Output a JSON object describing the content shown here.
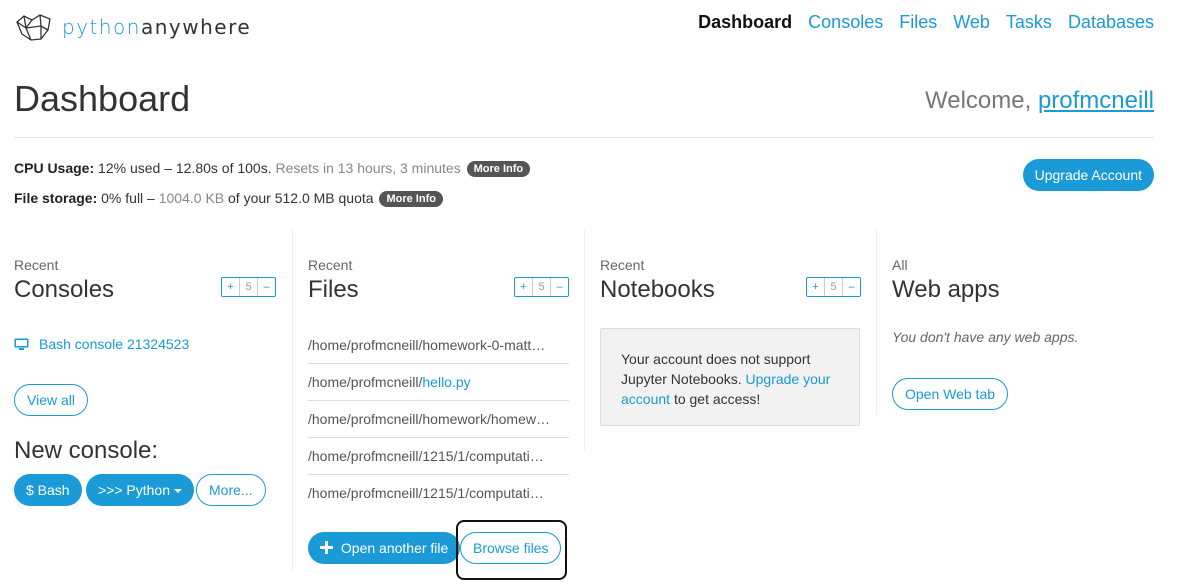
{
  "brand": {
    "part1": "python",
    "part2": "anywhere"
  },
  "nav": {
    "items": [
      {
        "label": "Dashboard",
        "active": true
      },
      {
        "label": "Consoles"
      },
      {
        "label": "Files"
      },
      {
        "label": "Web"
      },
      {
        "label": "Tasks"
      },
      {
        "label": "Databases"
      }
    ]
  },
  "page": {
    "title": "Dashboard",
    "welcome": "Welcome,",
    "username": "profmcneill"
  },
  "usage": {
    "cpu_label": "CPU Usage:",
    "cpu_value": "12% used – 12.80s of 100s.",
    "cpu_reset": "Resets in 13 hours, 3 minutes",
    "storage_label": "File storage:",
    "storage_pct": "0% full –",
    "storage_used": "1004.0 KB",
    "storage_quota": "of your 512.0 MB quota",
    "more_info": "More Info",
    "upgrade": "Upgrade Account"
  },
  "controls": {
    "plus": "+",
    "count": "5",
    "minus": "–"
  },
  "consoles": {
    "small": "Recent",
    "title": "Consoles",
    "recent": "Bash console 21324523",
    "view_all": "View all",
    "new_title": "New console:",
    "bash": "$ Bash",
    "python": ">>> Python",
    "more": "More..."
  },
  "files": {
    "small": "Recent",
    "title": "Files",
    "rows": [
      {
        "prefix": "/home/profmcneill/homework-0-matt…",
        "link": ""
      },
      {
        "prefix": "/home/profmcneill/",
        "link": "hello.py"
      },
      {
        "prefix": "/home/profmcneill/homework/homew…",
        "link": ""
      },
      {
        "prefix": "/home/profmcneill/1215/1/computati…",
        "link": ""
      },
      {
        "prefix": "/home/profmcneill/1215/1/computati…",
        "link": ""
      }
    ],
    "open_another": "Open another file",
    "browse": "Browse files"
  },
  "notebooks": {
    "small": "Recent",
    "title": "Notebooks",
    "msg1": "Your account does not support Jupyter Notebooks.",
    "msg_link": "Upgrade your account",
    "msg2": "to get access!"
  },
  "webapps": {
    "small": "All",
    "title": "Web apps",
    "empty": "You don't have any web apps.",
    "open_tab": "Open Web tab"
  },
  "colors": {
    "accent": "#1a9ad6",
    "pill": "#555555"
  }
}
